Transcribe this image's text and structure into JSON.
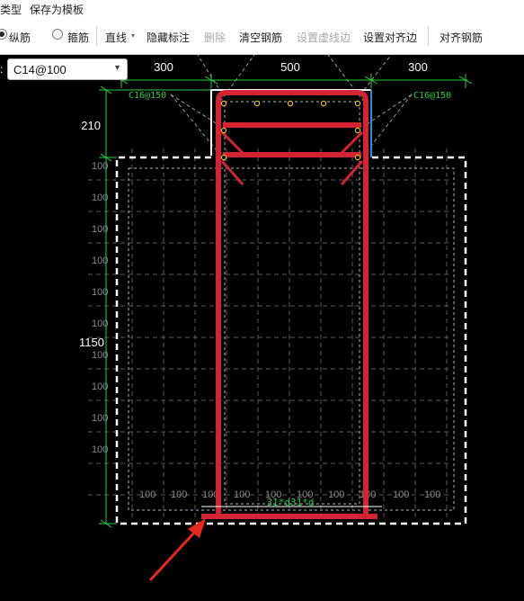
{
  "menu": {
    "type_tail": "类型",
    "save_template": "保存为模板"
  },
  "toolbar": {
    "longitudinal": "纵筋",
    "stirrup": "箍筋",
    "line": "直线",
    "hide_marks": "隐藏标注",
    "delete": "删除",
    "clear_rebar": "清空钢筋",
    "set_dashed_edge": "设置虚线边",
    "set_align_edge": "设置对齐边",
    "align_rebar": "对齐钢筋"
  },
  "selector": {
    "value": "C14@100"
  },
  "drawing": {
    "dim_top_left": "300",
    "dim_top_mid": "500",
    "dim_top_right": "300",
    "dim_left_top": "210",
    "dim_left_main": "1150",
    "grid_label": "100",
    "rebar_left": "C16@150",
    "rebar_right": "C16@150",
    "anchor_label": "31*d31*d",
    "colors": {
      "rebar": "#d42332",
      "dim": "#2ecc40",
      "green_text": "#2ecc40",
      "outline": "#ffffff",
      "accent_edge": "#2b8fe0",
      "arrow": "#e8281c"
    }
  }
}
